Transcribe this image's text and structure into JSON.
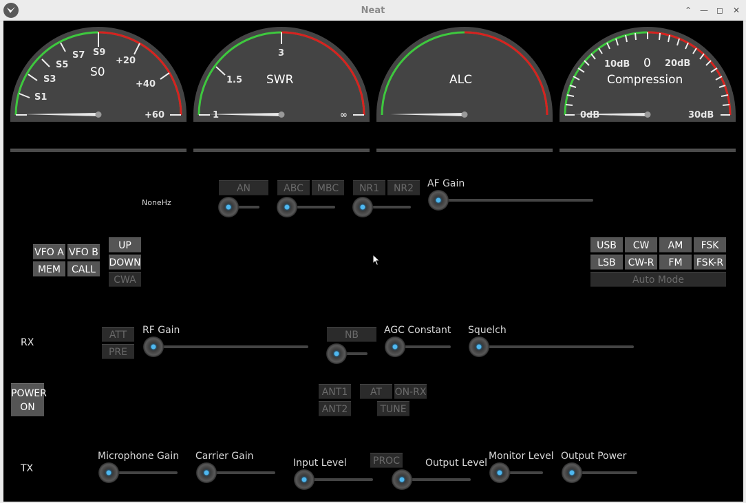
{
  "window": {
    "title": "Neat"
  },
  "meters": {
    "smeter": {
      "center": "S0",
      "ticks": [
        "S1",
        "S3",
        "S5",
        "S7",
        "S9",
        "+20",
        "+40",
        "+60"
      ]
    },
    "swr": {
      "center": "SWR",
      "ticks": [
        "1",
        "1.5",
        "3",
        "∞"
      ]
    },
    "alc": {
      "center": "ALC"
    },
    "compression": {
      "top": "0",
      "center": "Compression",
      "ticks": [
        "0dB",
        "10dB",
        "20dB",
        "30dB"
      ]
    }
  },
  "freq": {
    "value": "NoneHz"
  },
  "vfo": {
    "vfo_a": "VFO A",
    "vfo_b": "VFO B",
    "mem": "MEM",
    "call": "CALL",
    "up": "UP",
    "down": "DOWN",
    "cwa": "CWA"
  },
  "dsp": {
    "an": "AN",
    "abc": "ABC",
    "mbc": "MBC",
    "nr1": "NR1",
    "nr2": "NR2",
    "af_gain": "AF Gain"
  },
  "modes": {
    "usb": "USB",
    "cw": "CW",
    "am": "AM",
    "fsk": "FSK",
    "lsb": "LSB",
    "cwr": "CW-R",
    "fm": "FM",
    "fskr": "FSK-R",
    "auto": "Auto Mode"
  },
  "rx": {
    "label": "RX",
    "att": "ATT",
    "pre": "PRE",
    "rf_gain": "RF Gain",
    "nb": "NB",
    "agc": "AGC Constant",
    "squelch": "Squelch",
    "levels": {
      "rf_gain": 0.0,
      "nb": 0.0,
      "agc": 0.0,
      "squelch": 0.0,
      "af_gain": 0.0
    }
  },
  "antenna": {
    "ant1": "ANT1",
    "ant2": "ANT2",
    "at": "AT",
    "onrx": "ON-RX",
    "tune": "TUNE"
  },
  "power": {
    "line1": "POWER",
    "line2": "ON"
  },
  "tx": {
    "label": "TX",
    "mic_gain": "Microphone Gain",
    "carrier_gain": "Carrier Gain",
    "input_level": "Input Level",
    "proc": "PROC",
    "output_level": "Output Level",
    "monitor_level": "Monitor Level",
    "output_power": "Output Power"
  },
  "colors": {
    "background": "#000000",
    "button": "#555555",
    "button_disabled": "#2b2b2b",
    "knob_accent": "#4fb8f0",
    "scale_green": "#3ec83e",
    "scale_red": "#d82020"
  }
}
